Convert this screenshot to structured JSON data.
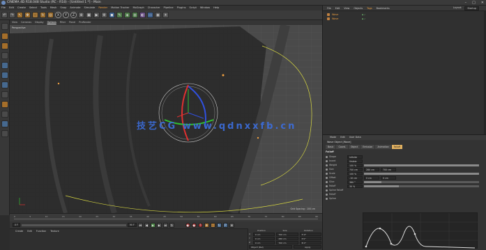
{
  "window": {
    "title": "CINEMA 4D R18.048 Studio (RC - R18) - [Untitled 1 *] - Main",
    "controls": [
      "–",
      "□",
      "✕"
    ]
  },
  "menubar": [
    "File",
    "Edit",
    "Create",
    "Select",
    "Tools",
    "Mesh",
    "Snap",
    "Animate",
    "Simulate",
    "Render",
    "Motion Tracker",
    "MoGraph",
    "Character",
    "Pipeline",
    "Plugins",
    "Script",
    "Window",
    "Help"
  ],
  "menubar_highlight": "Render",
  "viewport": {
    "menu": [
      "View",
      "Cameras",
      "Display",
      "Options",
      "Filter",
      "Panel",
      "ProRender"
    ],
    "selected_menu": "Options",
    "label": "Perspective",
    "info": "Grid Spacing : 100 cm",
    "watermark": "技艺CG www.qdnxxfb.cn"
  },
  "timeline": {
    "ticks": [
      "0",
      "5",
      "10",
      "15",
      "20",
      "25",
      "30",
      "35",
      "40",
      "45",
      "50",
      "55",
      "60",
      "65",
      "70",
      "75",
      "80",
      "85",
      "90"
    ]
  },
  "transport": {
    "start": "0 F",
    "current": "0 F",
    "end": "90 F",
    "max": "90 F"
  },
  "material": {
    "menu": [
      "Create",
      "Edit",
      "Function",
      "Texture"
    ]
  },
  "coordinates": {
    "headers": [
      "Position",
      "Size",
      "Rotation"
    ],
    "rows": [
      {
        "axis": "X",
        "pos": "0 cm",
        "size": "700 cm",
        "rot": "H  0°"
      },
      {
        "axis": "Y",
        "pos": "0 cm",
        "size": "280 cm",
        "rot": "P  0°"
      },
      {
        "axis": "Z",
        "pos": "0 cm",
        "size": "700 cm",
        "rot": "B  0°"
      }
    ],
    "mode": "Object (Rel)",
    "apply": "Apply"
  },
  "object_manager": {
    "menu": [
      "File",
      "Edit",
      "View",
      "Objects",
      "Tags",
      "Bookmarks"
    ],
    "highlight": "Tags",
    "layout_label": "Layout:",
    "layout_value": "Startup",
    "objects": [
      {
        "name": "Wave"
      },
      {
        "name": "Wave"
      }
    ]
  },
  "attributes": {
    "menu": [
      "Mode",
      "Edit",
      "User Data"
    ],
    "object_line": "Wave Object [Wave]",
    "tabs": [
      "Basic",
      "Coord.",
      "Object",
      "Emission",
      "Animation",
      "Falloff"
    ],
    "active_tab": "Falloff",
    "section": "Falloff",
    "rows": [
      {
        "label": "Shape",
        "value": "Infinite"
      },
      {
        "label": "Invert",
        "value": "Visible"
      },
      {
        "label": "Weight",
        "value": "100 %",
        "fill": 1.0
      },
      {
        "label": "Size",
        "value": "700 cm",
        "extra": [
          "280 cm",
          "700 cm"
        ]
      },
      {
        "label": "Scale",
        "value": "100 %",
        "fill": 1.0
      },
      {
        "label": "Offset",
        "value": "-10 cm",
        "extra": [
          "0 cm",
          "0 cm"
        ]
      },
      {
        "label": "Slice",
        "value": "360 °",
        "fill": 0.15
      },
      {
        "label": "Falloff",
        "value": "30 %",
        "fill": 0.3
      },
      {
        "label": "Spline Falloff"
      },
      {
        "label": "Falloff"
      },
      {
        "label": "Spline"
      }
    ]
  },
  "colors": {
    "accent": "#f0a040",
    "active_tab": "#e0b060",
    "watermark": "#3c6fe0",
    "gizmo_x": "#e03030",
    "gizmo_y": "#30c030",
    "gizmo_z": "#3050e0",
    "wireframe": "#d8d840"
  }
}
